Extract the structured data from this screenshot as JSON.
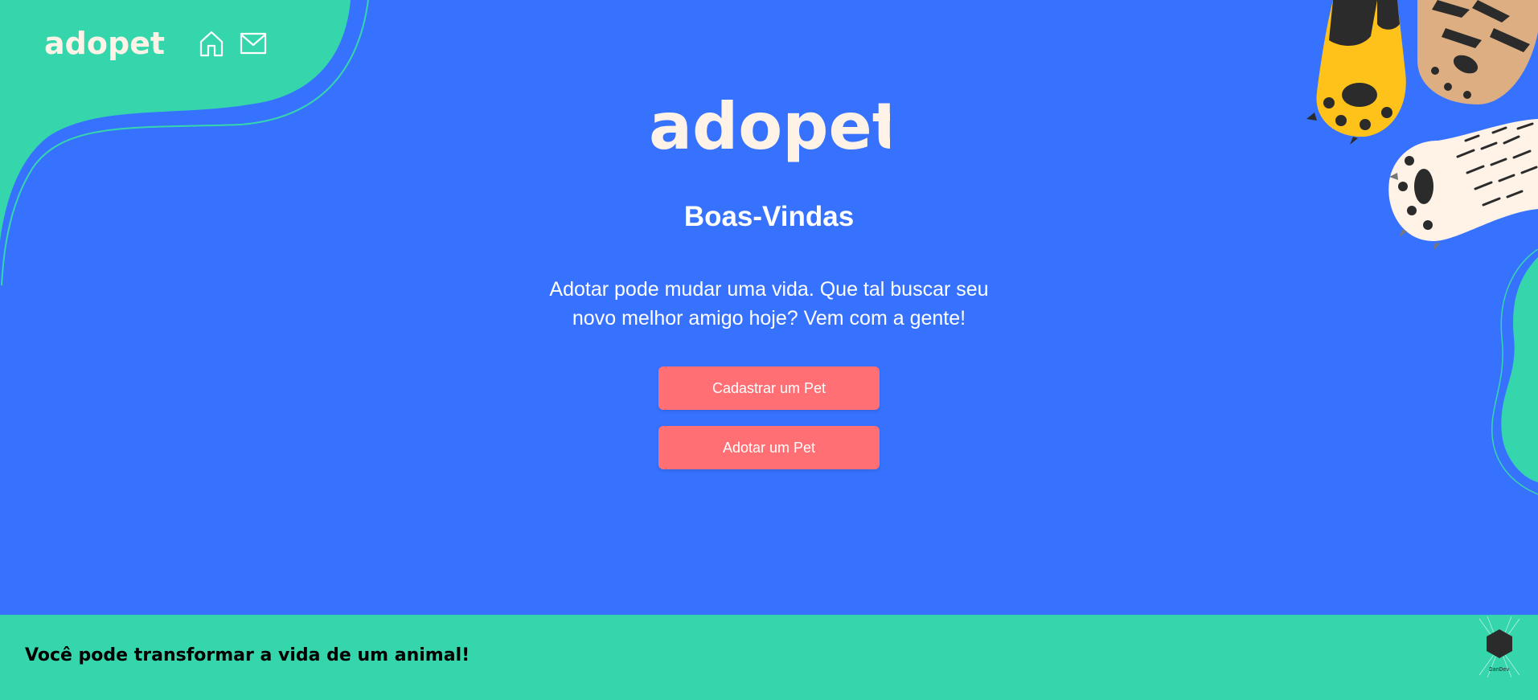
{
  "header": {
    "brand": "adopet",
    "home_icon": "home-icon",
    "mail_icon": "mail-icon"
  },
  "main": {
    "logo": "adopet",
    "welcome": "Boas-Vindas",
    "subtitle": "Adotar pode mudar uma vida. Que tal buscar seu novo melhor amigo hoje? Vem com a gente!",
    "register_button": "Cadastrar um Pet",
    "adopt_button": "Adotar um Pet"
  },
  "footer": {
    "text": "Você pode transformar a vida de um animal!",
    "badge": "DanDev"
  },
  "colors": {
    "background": "#3772FF",
    "accent_green": "#36D6AD",
    "button": "#FF6F73",
    "logo": "#FFF3E8"
  }
}
